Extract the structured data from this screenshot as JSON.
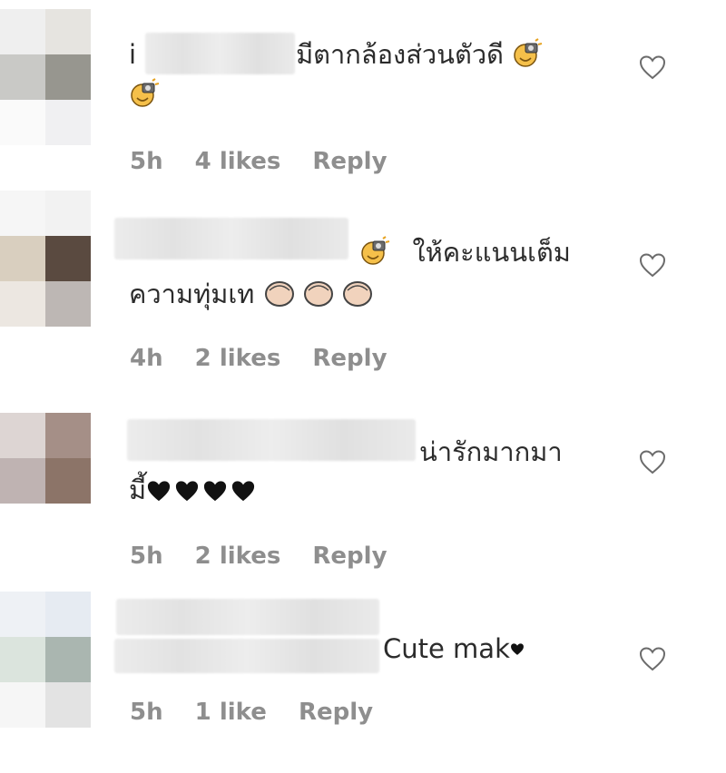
{
  "comments": [
    {
      "text_line1_prefix": "i",
      "text_line1": "มีตากล้องส่วนตัวดี",
      "time": "5h",
      "likes": "4 likes",
      "reply": "Reply"
    },
    {
      "text_line1": "ให้คะแนนเต็ม",
      "text_line2": "ความทุ่มเท",
      "time": "4h",
      "likes": "2 likes",
      "reply": "Reply"
    },
    {
      "text_line1": "น่ารักมากมา",
      "text_line2": "มี้",
      "time": "5h",
      "likes": "2 likes",
      "reply": "Reply"
    },
    {
      "text_line1": "Cute mak",
      "time": "5h",
      "likes": "1 like",
      "reply": "Reply"
    }
  ],
  "icons": {
    "like": "heart-outline-icon",
    "emoji_photo": "camera-flash-face-emoji",
    "emoji_hands": "clapping-hands-emoji",
    "emoji_heart": "black-heart-emoji"
  }
}
